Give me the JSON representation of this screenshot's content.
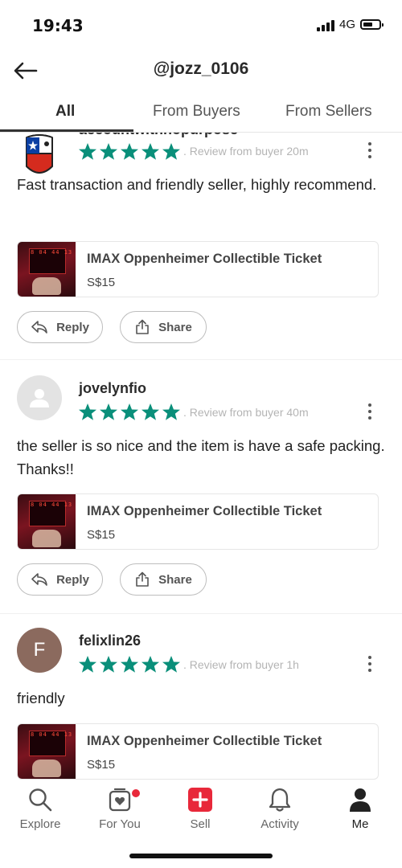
{
  "status": {
    "time": "19:43",
    "network": "4G"
  },
  "header": {
    "title": "@jozz_0106"
  },
  "tabs": [
    {
      "label": "All",
      "active": true
    },
    {
      "label": "From Buyers",
      "active": false
    },
    {
      "label": "From Sellers",
      "active": false
    }
  ],
  "reviews": [
    {
      "username": "accountwithnopurpose",
      "rating": 5,
      "meta": ". Review from buyer 20m",
      "text": "Fast transaction and friendly seller, highly recommend.",
      "item": {
        "title": "IMAX Oppenheimer Collectible Ticket",
        "price": "S$15"
      },
      "avatar": "flag-avatar"
    },
    {
      "username": "jovelynfio",
      "rating": 5,
      "meta": ". Review from buyer 40m",
      "text": "the seller is so nice and the item is have a safe packing. Thanks!!",
      "item": {
        "title": "IMAX Oppenheimer Collectible Ticket",
        "price": "S$15"
      },
      "avatar": "default-avatar"
    },
    {
      "username": "felixlin26",
      "rating": 5,
      "meta": ". Review from buyer 1h",
      "text": "friendly",
      "item": {
        "title": "IMAX Oppenheimer Collectible Ticket",
        "price": "S$15"
      },
      "avatar": "F"
    }
  ],
  "buttons": {
    "reply": "Reply",
    "share": "Share"
  },
  "bottom_nav": [
    {
      "label": "Explore",
      "icon": "search-icon",
      "active": false
    },
    {
      "label": "For You",
      "icon": "for-you-icon",
      "active": false,
      "badge": true
    },
    {
      "label": "Sell",
      "icon": "sell-plus-icon",
      "active": false
    },
    {
      "label": "Activity",
      "icon": "bell-icon",
      "active": false
    },
    {
      "label": "Me",
      "icon": "person-icon",
      "active": true
    }
  ],
  "colors": {
    "star": "#0a8f7a",
    "sell": "#e8283a",
    "badge": "#e8283a"
  }
}
